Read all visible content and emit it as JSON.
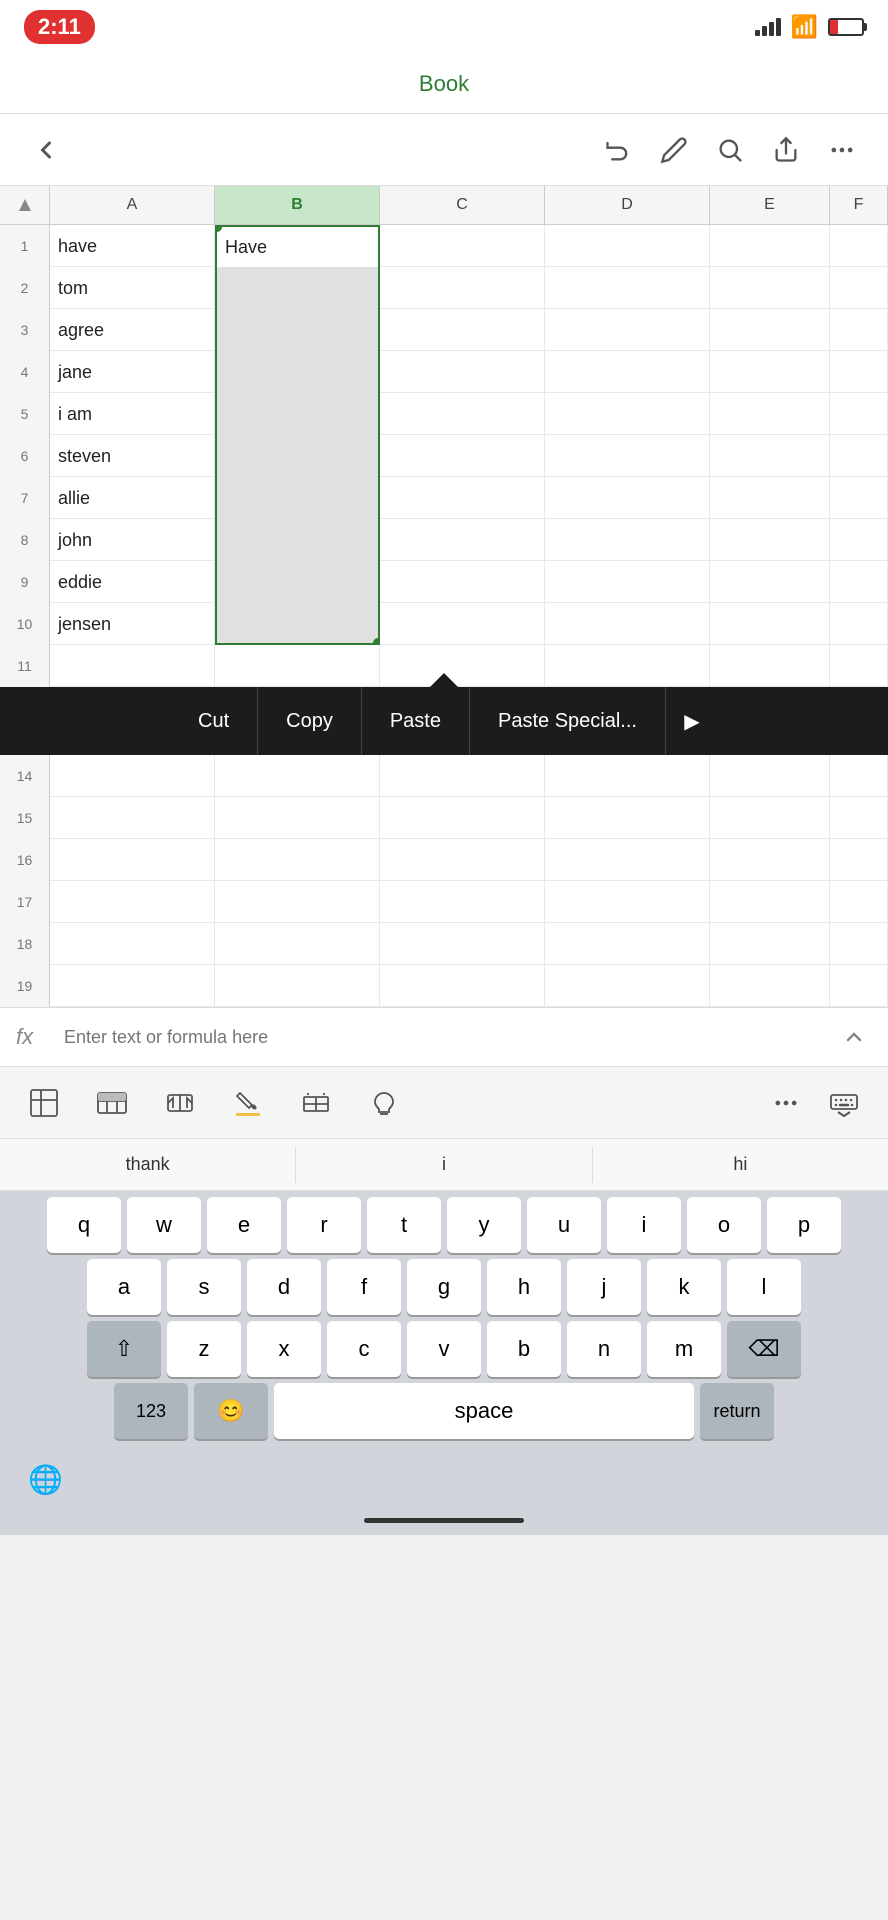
{
  "statusBar": {
    "time": "2:11"
  },
  "titleBar": {
    "title": "Book"
  },
  "toolbar": {
    "backLabel": "‹",
    "undoLabel": "↩",
    "drawLabel": "✏",
    "searchLabel": "⌕",
    "shareLabel": "↑",
    "moreLabel": "···"
  },
  "spreadsheet": {
    "columns": [
      "",
      "A",
      "B",
      "C",
      "D",
      "E",
      "F"
    ],
    "rows": [
      {
        "num": 1,
        "a": "have",
        "b": "Have",
        "bSelected": true
      },
      {
        "num": 2,
        "a": "tom",
        "b": "",
        "bSelected": false
      },
      {
        "num": 3,
        "a": "agree",
        "b": "",
        "bSelected": false
      },
      {
        "num": 4,
        "a": "jane",
        "b": "",
        "bSelected": false
      },
      {
        "num": 5,
        "a": "i am",
        "b": "",
        "bSelected": false
      },
      {
        "num": 6,
        "a": "steven",
        "b": "",
        "bSelected": false
      },
      {
        "num": 7,
        "a": "allie",
        "b": "",
        "bSelected": false
      },
      {
        "num": 8,
        "a": "john",
        "b": "",
        "bSelected": false
      },
      {
        "num": 9,
        "a": "eddie",
        "b": "",
        "bSelected": false
      },
      {
        "num": 10,
        "a": "jensen",
        "b": "",
        "bSelected": true
      },
      {
        "num": 11,
        "a": "",
        "b": "",
        "bSelected": false
      },
      {
        "num": 14,
        "a": "",
        "b": "",
        "bSelected": false
      },
      {
        "num": 15,
        "a": "",
        "b": "",
        "bSelected": false
      },
      {
        "num": 16,
        "a": "",
        "b": "",
        "bSelected": false
      },
      {
        "num": 17,
        "a": "",
        "b": "",
        "bSelected": false
      },
      {
        "num": 18,
        "a": "",
        "b": "",
        "bSelected": false
      },
      {
        "num": 19,
        "a": "",
        "b": "",
        "bSelected": false
      }
    ]
  },
  "contextMenu": {
    "cut": "Cut",
    "copy": "Copy",
    "paste": "Paste",
    "pasteSpecial": "Paste Special...",
    "moreArrow": "▶"
  },
  "formulaBar": {
    "label": "fx",
    "placeholder": "Enter text or formula here",
    "expandIcon": "⌃"
  },
  "bottomToolbar": {
    "cellFormatIcon": "cell-format",
    "tableIcon": "table",
    "resizeIcon": "resize",
    "fillColorIcon": "fill-color",
    "borderIcon": "border",
    "lightbulbIcon": "lightbulb",
    "moreIcon": "···",
    "keyboardIcon": "keyboard"
  },
  "autocomplete": {
    "items": [
      "thank",
      "i",
      "hi"
    ]
  },
  "keyboard": {
    "row1": [
      "q",
      "w",
      "e",
      "r",
      "t",
      "y",
      "u",
      "i",
      "o",
      "p"
    ],
    "row2": [
      "a",
      "s",
      "d",
      "f",
      "g",
      "h",
      "j",
      "k",
      "l"
    ],
    "row3": [
      "z",
      "x",
      "c",
      "v",
      "b",
      "n",
      "m"
    ],
    "spaceLabel": "space",
    "returnLabel": "return",
    "numbersLabel": "123",
    "deleteIcon": "⌫",
    "shiftIcon": "⇧",
    "globeIcon": "🌐"
  }
}
